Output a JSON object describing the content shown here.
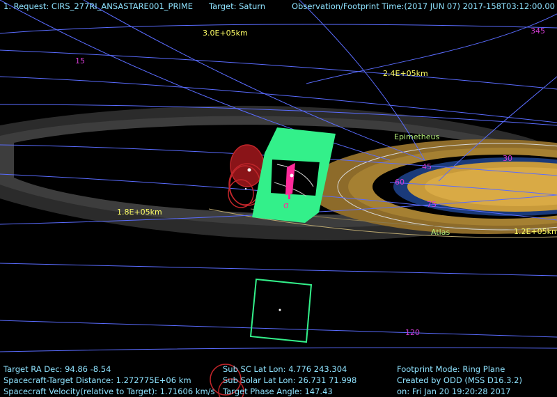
{
  "header": {
    "request": "1. Request: CIRS_277RI_ANSASTARE001_PRIME",
    "target": "Target: Saturn",
    "obs_time": "Observation/Footprint Time:(2017 JUN 07) 2017-158T03:12:00.00"
  },
  "radius_labels": [
    "3.0E+05km",
    "2.4E+05km",
    "1.8E+05km",
    "1.2E+05km"
  ],
  "longitude_labels": [
    "15",
    "345",
    "45",
    "30",
    "60",
    "75",
    "120"
  ],
  "moons": [
    "Epimetheus",
    "Atlas"
  ],
  "footprint_marker": "σ",
  "footer": {
    "ra_dec": "Target RA Dec: 94.86  -8.54",
    "distance": "Spacecraft-Target Distance: 1.272775E+06 km",
    "velocity": "Spacecraft Velocity(relative to Target): 1.71606 km/s",
    "sub_sc": "Sub SC Lat Lon:  4.776  243.304",
    "sub_solar": "Sub Solar Lat Lon: 26.731  71.998",
    "phase": "Target Phase Angle: 147.43",
    "mode": "Footprint Mode: Ring Plane",
    "created": "Created by ODD (MSS D16.3.2)",
    "date": "on: Fri Jan 20 19:20:28 2017"
  },
  "colors": {
    "background": "#000000",
    "grid": "#5a6cff",
    "ring_gray": "#3a3a3a",
    "ring_gold": "#c89a3a",
    "footprint": "#33f08a",
    "circles": "#c0252a",
    "pink": "#ff2a9a"
  }
}
